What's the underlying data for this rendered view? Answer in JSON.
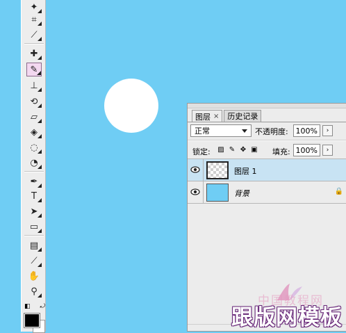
{
  "canvas": {
    "background": "#6fcdf4",
    "shape_color": "#ffffff"
  },
  "toolbar": {
    "tools": [
      {
        "name": "magic-wand-icon",
        "glyph": "✦"
      },
      {
        "name": "crop-icon",
        "glyph": "⌗"
      },
      {
        "name": "slice-icon",
        "glyph": "⟋"
      },
      {
        "name": "healing-brush-icon",
        "glyph": "✚"
      },
      {
        "name": "brush-icon",
        "glyph": "✎",
        "selected": true
      },
      {
        "name": "clone-stamp-icon",
        "glyph": "⊥"
      },
      {
        "name": "history-brush-icon",
        "glyph": "⟲"
      },
      {
        "name": "eraser-icon",
        "glyph": "▱"
      },
      {
        "name": "paint-bucket-icon",
        "glyph": "◈"
      },
      {
        "name": "blur-icon",
        "glyph": "◌"
      },
      {
        "name": "dodge-icon",
        "glyph": "◔"
      },
      {
        "name": "pen-icon",
        "glyph": "✒"
      },
      {
        "name": "type-icon",
        "glyph": "T"
      },
      {
        "name": "path-selection-icon",
        "glyph": "➤"
      },
      {
        "name": "rectangle-icon",
        "glyph": "▭"
      },
      {
        "name": "notes-icon",
        "glyph": "▤"
      },
      {
        "name": "eyedropper-icon",
        "glyph": "⟋"
      },
      {
        "name": "hand-icon",
        "glyph": "✋"
      },
      {
        "name": "zoom-icon",
        "glyph": "⚲"
      }
    ],
    "foreground_color": "#000000",
    "background_color": "#ffffff"
  },
  "layers_panel": {
    "tabs": [
      {
        "label": "图层",
        "active": true
      },
      {
        "label": "历史记录",
        "active": false
      }
    ],
    "blend_mode": "正常",
    "opacity_label": "不透明度:",
    "opacity_value": "100%",
    "lock_label": "锁定:",
    "fill_label": "填充:",
    "fill_value": "100%",
    "layers": [
      {
        "name": "图层 1",
        "visible": true,
        "active": true,
        "thumbnail": "transparent"
      },
      {
        "name": "背景",
        "visible": true,
        "active": false,
        "thumbnail": "#6fcdf4",
        "locked": true
      }
    ]
  },
  "watermark": {
    "subtitle": "中国教程网",
    "title": "跟版网模板"
  }
}
